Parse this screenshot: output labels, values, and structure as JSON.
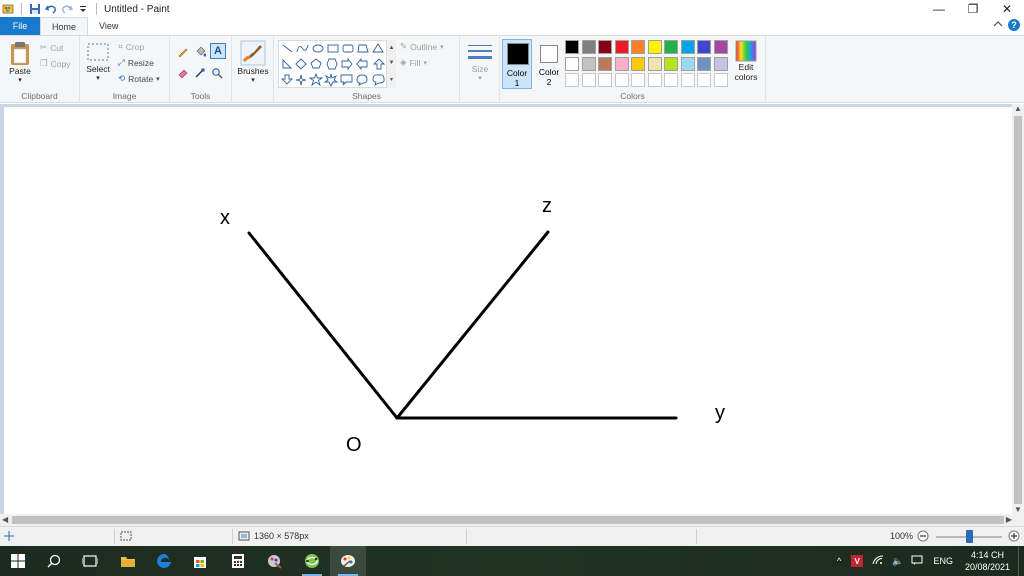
{
  "window": {
    "title": "Untitled - Paint",
    "controls": {
      "minimize": "—",
      "restore": "❐",
      "close": "✕"
    }
  },
  "tabs": {
    "file": "File",
    "home": "Home",
    "view": "View"
  },
  "ribbon": {
    "clipboard": {
      "label": "Clipboard",
      "paste": "Paste",
      "cut": "Cut",
      "copy": "Copy"
    },
    "image": {
      "label": "Image",
      "select": "Select",
      "crop": "Crop",
      "resize": "Resize",
      "rotate": "Rotate"
    },
    "tools": {
      "label": "Tools"
    },
    "brushes": {
      "label": "Brushes"
    },
    "shapes": {
      "label": "Shapes",
      "outline": "Outline",
      "fill": "Fill"
    },
    "size": {
      "label": "Size"
    },
    "colors": {
      "label": "Colors",
      "color1_label": "Color",
      "color1_num": "1",
      "color2_label": "Color",
      "color2_num": "2",
      "color1": "#000000",
      "color2": "#ffffff",
      "edit_label1": "Edit",
      "edit_label2": "colors",
      "palette_row1": [
        "#000000",
        "#7f7f7f",
        "#880015",
        "#ed1c24",
        "#ff7f27",
        "#fff200",
        "#22b14c",
        "#00a2e8",
        "#3f48cc",
        "#a349a4"
      ],
      "palette_row2": [
        "#ffffff",
        "#c3c3c3",
        "#b97a57",
        "#ffaec9",
        "#ffc90e",
        "#efe4b0",
        "#b5e61d",
        "#99d9ea",
        "#7092be",
        "#c8bfe7"
      ]
    }
  },
  "canvas": {
    "labels": {
      "x": "x",
      "z": "z",
      "o": "O",
      "y": "y"
    },
    "line_color": "#000000"
  },
  "status": {
    "dimensions": "1360 × 578px",
    "zoom": "100%",
    "zoom_slider_level": 0.5
  },
  "taskbar": {
    "language": "ENG",
    "time": "4:14 CH",
    "date": "20/08/2021"
  }
}
